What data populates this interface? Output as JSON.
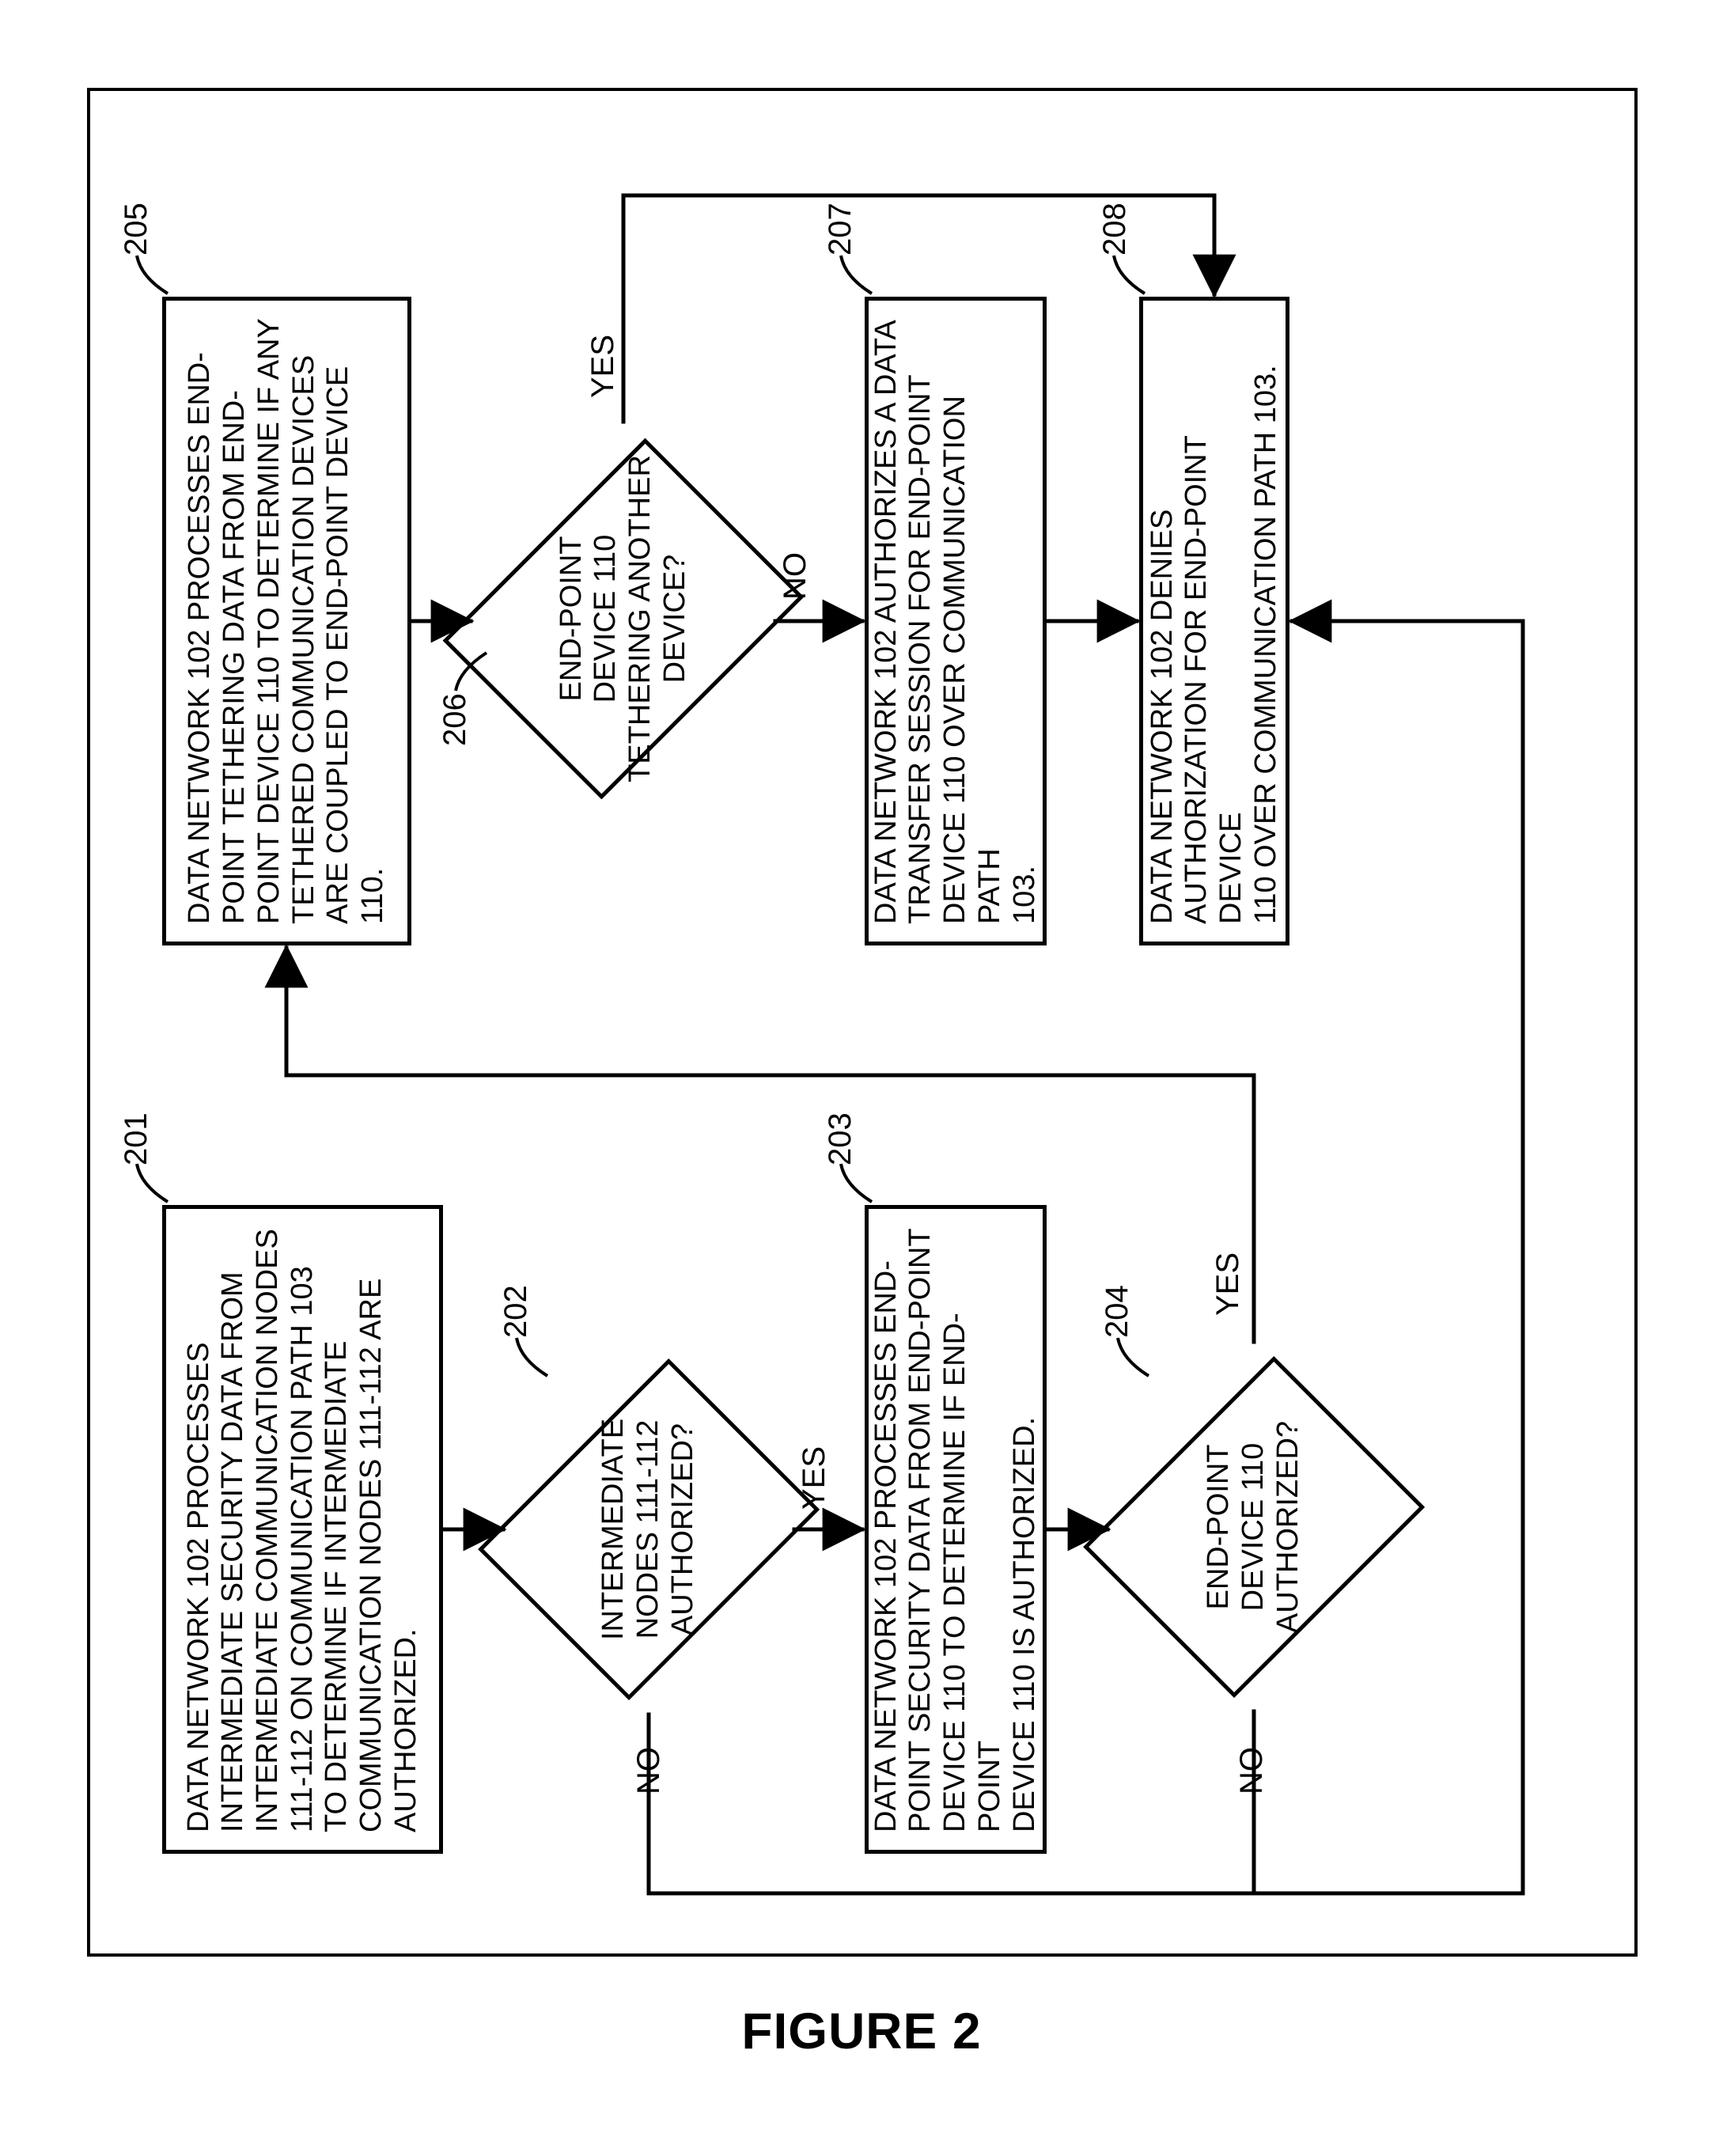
{
  "figure_label": "FIGURE 2",
  "node201": {
    "tag": "201",
    "text": "DATA NETWORK 102 PROCESSES\nINTERMEDIATE SECURITY DATA FROM\nINTERMEDIATE COMMUNICATION NODES\n111-112 ON COMMUNICATION PATH 103\nTO DETERMINE IF INTERMEDIATE\nCOMMUNICATION NODES 111-112 ARE\nAUTHORIZED."
  },
  "node202": {
    "tag": "202",
    "text": "INTERMEDIATE\nNODES 111-112\nAUTHORIZED?"
  },
  "node203": {
    "tag": "203",
    "text": "DATA NETWORK 102 PROCESSES END-\nPOINT SECURITY DATA FROM END-POINT\nDEVICE 110 TO DETERMINE IF END-POINT\nDEVICE 110 IS AUTHORIZED."
  },
  "node204": {
    "tag": "204",
    "text": "END-POINT\nDEVICE 110\nAUTHORIZED?"
  },
  "node205": {
    "tag": "205",
    "text": "DATA NETWORK 102 PROCESSES END-\nPOINT TETHERING DATA FROM END-\nPOINT DEVICE 110 TO DETERMINE IF ANY\nTETHERED COMMUNICATION DEVICES\nARE COUPLED TO END-POINT DEVICE\n110."
  },
  "node206": {
    "tag": "206",
    "text": "END-POINT\nDEVICE 110\nTETHERING ANOTHER\nDEVICE?"
  },
  "node207": {
    "tag": "207",
    "text": "DATA NETWORK 102 AUTHORIZES A DATA\nTRANSFER SESSION FOR END-POINT\nDEVICE 110 OVER COMMUNICATION PATH\n103."
  },
  "node208": {
    "tag": "208",
    "text": "DATA NETWORK 102 DENIES\nAUTHORIZATION FOR END-POINT DEVICE\n110 OVER COMMUNICATION PATH 103."
  },
  "labels": {
    "yes": "YES",
    "no": "NO"
  },
  "chart_data": {
    "type": "flowchart",
    "title": "FIGURE 2",
    "nodes": [
      {
        "id": "201",
        "type": "process",
        "text": "DATA NETWORK 102 PROCESSES INTERMEDIATE SECURITY DATA FROM INTERMEDIATE COMMUNICATION NODES 111-112 ON COMMUNICATION PATH 103 TO DETERMINE IF INTERMEDIATE COMMUNICATION NODES 111-112 ARE AUTHORIZED."
      },
      {
        "id": "202",
        "type": "decision",
        "text": "INTERMEDIATE NODES 111-112 AUTHORIZED?"
      },
      {
        "id": "203",
        "type": "process",
        "text": "DATA NETWORK 102 PROCESSES END-POINT SECURITY DATA FROM END-POINT DEVICE 110 TO DETERMINE IF END-POINT DEVICE 110 IS AUTHORIZED."
      },
      {
        "id": "204",
        "type": "decision",
        "text": "END-POINT DEVICE 110 AUTHORIZED?"
      },
      {
        "id": "205",
        "type": "process",
        "text": "DATA NETWORK 102 PROCESSES END-POINT TETHERING DATA FROM END-POINT DEVICE 110 TO DETERMINE IF ANY TETHERED COMMUNICATION DEVICES ARE COUPLED TO END-POINT DEVICE 110."
      },
      {
        "id": "206",
        "type": "decision",
        "text": "END-POINT DEVICE 110 TETHERING ANOTHER DEVICE?"
      },
      {
        "id": "207",
        "type": "process",
        "text": "DATA NETWORK 102 AUTHORIZES A DATA TRANSFER SESSION FOR END-POINT DEVICE 110 OVER COMMUNICATION PATH 103."
      },
      {
        "id": "208",
        "type": "process",
        "text": "DATA NETWORK 102 DENIES AUTHORIZATION FOR END-POINT DEVICE 110 OVER COMMUNICATION PATH 103."
      }
    ],
    "edges": [
      {
        "from": "201",
        "to": "202",
        "label": ""
      },
      {
        "from": "202",
        "to": "203",
        "label": "YES"
      },
      {
        "from": "202",
        "to": "208",
        "label": "NO"
      },
      {
        "from": "203",
        "to": "204",
        "label": ""
      },
      {
        "from": "204",
        "to": "205",
        "label": "YES"
      },
      {
        "from": "204",
        "to": "208",
        "label": "NO"
      },
      {
        "from": "205",
        "to": "206",
        "label": ""
      },
      {
        "from": "206",
        "to": "207",
        "label": "NO"
      },
      {
        "from": "206",
        "to": "208",
        "label": "YES"
      },
      {
        "from": "207",
        "to": "208",
        "label": ""
      }
    ]
  }
}
